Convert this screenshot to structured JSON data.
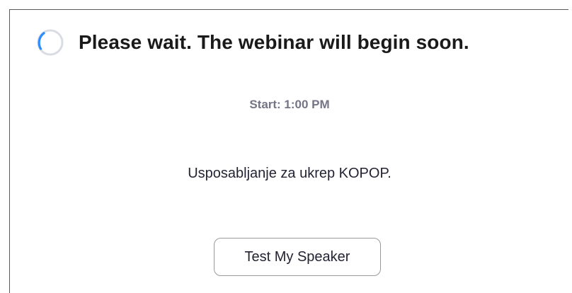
{
  "waiting_room": {
    "title": "Please wait. The webinar will begin soon.",
    "start_time": "Start: 1:00 PM",
    "topic": "Usposabljanje za ukrep KOPOP.",
    "test_speaker_label": "Test My Speaker",
    "spinner_icon": "loading-spinner-icon"
  },
  "colors": {
    "spinner_track": "#d9dde3",
    "spinner_arc": "#2d8cff",
    "subtle_text": "#747487",
    "body_text": "#232333"
  }
}
